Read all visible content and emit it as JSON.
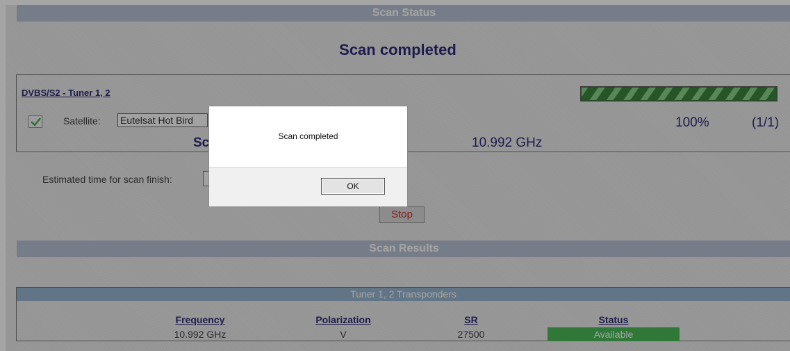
{
  "scan_status": {
    "header": "Scan Status",
    "title": "Scan completed"
  },
  "tuner": {
    "link_label": "DVBS/S2 - Tuner 1, 2",
    "satellite_label": "Satellite:",
    "satellite_value": "Eutelsat Hot Bird",
    "scan_word": "Sc",
    "frequency": "10.992 GHz",
    "progress_percent_text": "100%",
    "progress_fraction": 1.0,
    "progress_count": "(1/1)"
  },
  "estimate": {
    "label": "Estimated time for scan finish:"
  },
  "stop_button": {
    "label": "Stop"
  },
  "scan_results": {
    "header": "Scan Results",
    "table_title": "Tuner 1, 2 Transponders",
    "columns": [
      "Frequency",
      "Polarization",
      "SR",
      "Status"
    ],
    "rows": [
      {
        "frequency": "10.992 GHz",
        "polarization": "V",
        "sr": "27500",
        "status": "Available"
      }
    ]
  },
  "dialog": {
    "message": "Scan completed",
    "ok_label": "OK"
  },
  "colors": {
    "title_text": "#1c1c6b",
    "section_bar": "#b3bccf",
    "table_header": "#8fb0cc",
    "status_available": "#3cb44a",
    "stop_text": "#c02020"
  }
}
